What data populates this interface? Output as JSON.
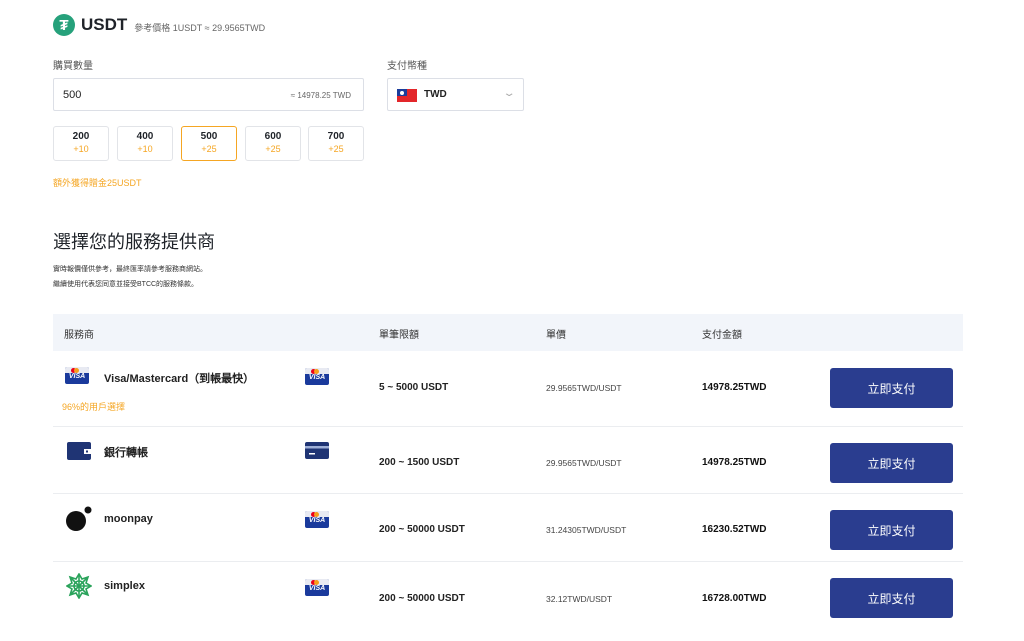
{
  "header": {
    "coin_symbol": "₮",
    "coin_name": "USDT",
    "ref_price": "參考價格 1USDT ≈ 29.9565TWD"
  },
  "purchase": {
    "amount_label": "購買數量",
    "amount_value": "500",
    "amount_approx": "≈ 14978.25 TWD",
    "currency_label": "支付幣種",
    "currency_code": "TWD",
    "presets": [
      {
        "qty": "200",
        "bonus": "+10",
        "active": false
      },
      {
        "qty": "400",
        "bonus": "+10",
        "active": false
      },
      {
        "qty": "500",
        "bonus": "+25",
        "active": true
      },
      {
        "qty": "600",
        "bonus": "+25",
        "active": false
      },
      {
        "qty": "700",
        "bonus": "+25",
        "active": false
      }
    ],
    "bonus_note": "額外獲得贈金25USDT"
  },
  "providers_section": {
    "title": "選擇您的服務提供商",
    "disclaimer_1": "實時報價僅供參考，最終匯率請參考服務商網站。",
    "disclaimer_2": "繼續使用代表您同意並接受BTCC的服務條款。"
  },
  "table": {
    "headers": {
      "provider": "服務商",
      "limit": "單筆限額",
      "unit_price": "單價",
      "total": "支付金額"
    },
    "rows": [
      {
        "name": "Visa/Mastercard（到帳最快）",
        "hint": "96%的用戶選擇",
        "limit": "5 ~ 5000 USDT",
        "unit_price": "29.9565TWD/USDT",
        "total": "14978.25TWD",
        "button": "立即支付"
      },
      {
        "name": "銀行轉帳",
        "hint": "",
        "limit": "200 ~ 1500 USDT",
        "unit_price": "29.9565TWD/USDT",
        "total": "14978.25TWD",
        "button": "立即支付"
      },
      {
        "name": "moonpay",
        "hint": "",
        "limit": "200 ~ 50000 USDT",
        "unit_price": "31.24305TWD/USDT",
        "total": "16230.52TWD",
        "button": "立即支付"
      },
      {
        "name": "simplex",
        "hint": "",
        "limit": "200 ~ 50000 USDT",
        "unit_price": "32.12TWD/USDT",
        "total": "16728.00TWD",
        "button": "立即支付"
      }
    ]
  },
  "icons": {
    "visa_text": "VISA",
    "tether": "tether-icon",
    "visa": "visa-card-icon",
    "bank": "bank-card-icon",
    "moonpay": "moonpay-icon",
    "simplex": "simplex-icon",
    "flag": "taiwan-flag-icon",
    "chevron": "chevron-down-icon"
  },
  "colors": {
    "accent": "#f5a623",
    "button": "#2a3d8f",
    "table_head_bg": "#f2f5fa",
    "tether_green": "#26a17b"
  }
}
